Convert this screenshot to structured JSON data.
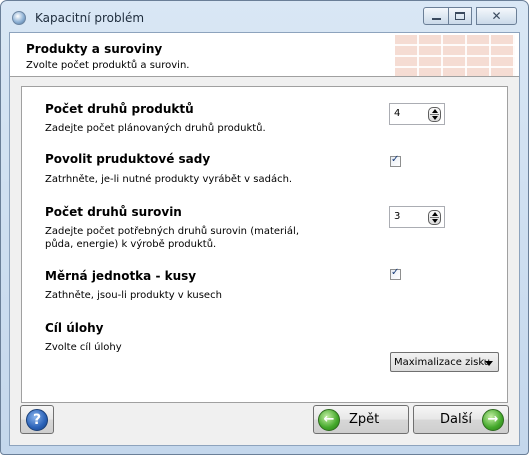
{
  "window": {
    "title": "Kapacitní problém",
    "icon": "app-icon"
  },
  "header": {
    "title": "Produkty a suroviny",
    "subtitle": "Zvolte počet produktů a surovin."
  },
  "fields": {
    "products": {
      "title": "Počet druhů produktů",
      "description": "Zadejte počet plánovaných druhů produktů.",
      "value": "4"
    },
    "sets": {
      "title": "Povolit pruduktové sady",
      "description": "Zatrhněte, je-li nutné produkty vyrábět v sadách.",
      "checked": true
    },
    "materials": {
      "title": "Počet druhů surovin",
      "description": "Zadejte počet potřebných druhů surovin (materiál, půda, energie) k výrobě produktů.",
      "value": "3"
    },
    "units": {
      "title": "Měrná jednotka - kusy",
      "description": "Zathněte, jsou-li produkty v kusech",
      "checked": true
    },
    "goal": {
      "title": "Cíl úlohy",
      "description": "Zvolte cíl úlohy",
      "selected": "Maximalizace zisku"
    }
  },
  "footer": {
    "help_icon": "question-mark-icon",
    "back_label": "Zpět",
    "next_label": "Další"
  },
  "colors": {
    "arrow_green": "#43a82a",
    "help_blue": "#2a62b8"
  }
}
